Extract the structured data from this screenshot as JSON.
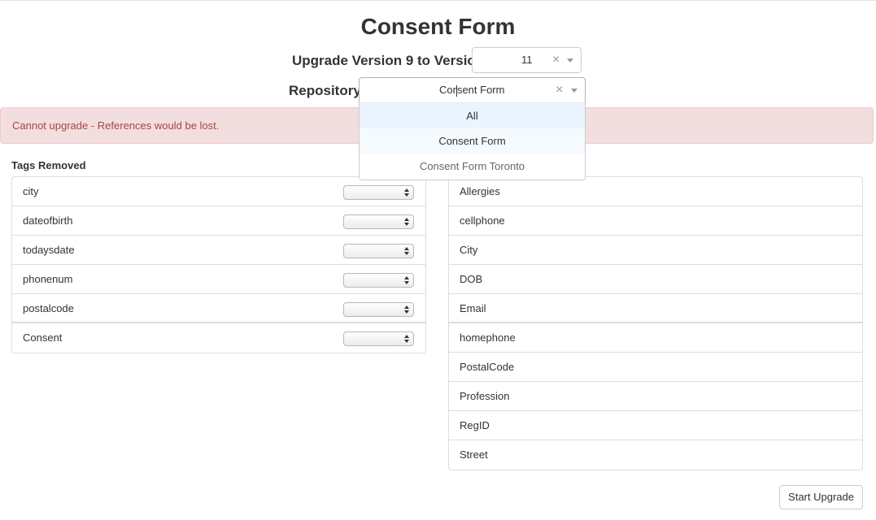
{
  "page": {
    "title": "Consent Form"
  },
  "upgrade": {
    "label": "Upgrade Version 9 to Version",
    "version_value": "11",
    "clear_glyph": "×"
  },
  "repository": {
    "label": "Repository",
    "input_value_before_caret": "Cor",
    "input_value_after_caret": "sent Form",
    "clear_glyph": "×",
    "options": [
      "All",
      "Consent Form",
      "Consent Form Toronto"
    ]
  },
  "alert": {
    "message": "Cannot upgrade - References would be lost."
  },
  "tags_removed": {
    "heading": "Tags Removed",
    "items": [
      "city",
      "dateofbirth",
      "todaysdate",
      "phonenum",
      "postalcode",
      "Consent"
    ]
  },
  "tags_added": {
    "items": [
      "Allergies",
      "cellphone",
      "City",
      "DOB",
      "Email",
      "homephone",
      "PostalCode",
      "Profession",
      "RegID",
      "Street"
    ]
  },
  "actions": {
    "start_upgrade": "Start Upgrade"
  },
  "icons": {
    "clear": "close-icon",
    "dropdown": "chevron-down-icon",
    "stepper": "up-down-arrows-icon"
  }
}
